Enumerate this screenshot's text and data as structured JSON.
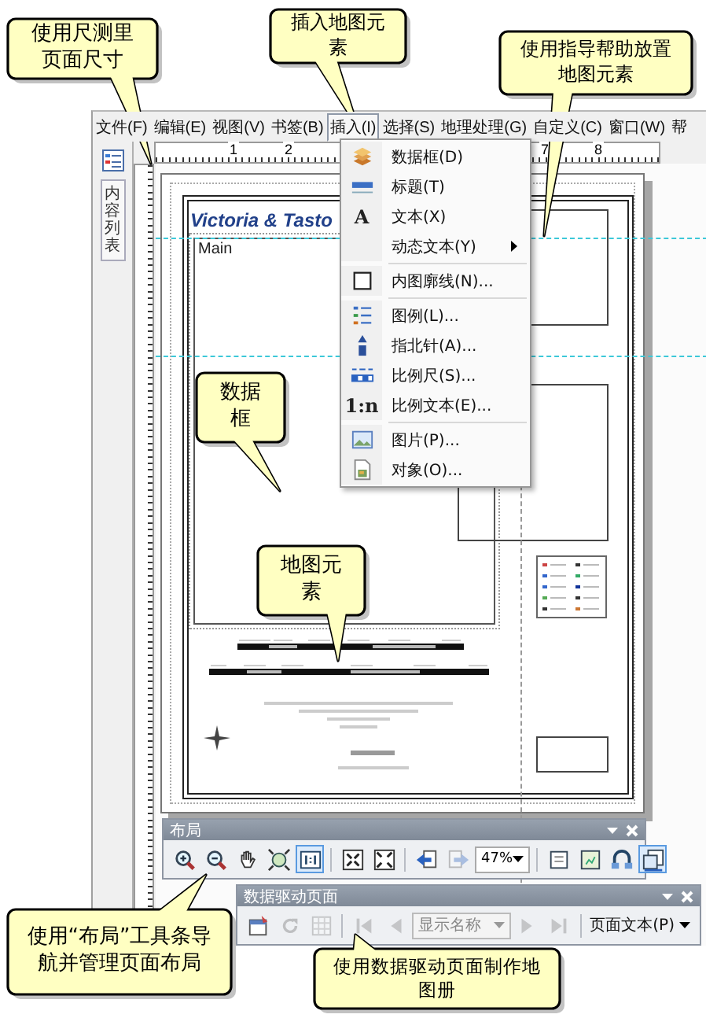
{
  "menu_bar": {
    "items": [
      {
        "label": "文件(F)",
        "selected": false
      },
      {
        "label": "编辑(E)",
        "selected": false
      },
      {
        "label": "视图(V)",
        "selected": false
      },
      {
        "label": "书签(B)",
        "selected": false
      },
      {
        "label": "插入(I)",
        "selected": true
      },
      {
        "label": "选择(S)",
        "selected": false
      },
      {
        "label": "地理处理(G)",
        "selected": false
      },
      {
        "label": "自定义(C)",
        "selected": false
      },
      {
        "label": "窗口(W)",
        "selected": false
      },
      {
        "label": "帮",
        "selected": false
      }
    ]
  },
  "insert_menu": {
    "groups": [
      [
        {
          "label": "数据框(D)",
          "kind": "data-frame",
          "submenu": false
        },
        {
          "label": "标题(T)",
          "kind": "title",
          "submenu": false
        },
        {
          "label": "文本(X)",
          "kind": "text",
          "glyph": "A",
          "submenu": false
        },
        {
          "label": "动态文本(Y)",
          "kind": "none",
          "submenu": true
        }
      ],
      [
        {
          "label": "内图廓线(N)...",
          "kind": "neatline",
          "submenu": false
        }
      ],
      [
        {
          "label": "图例(L)...",
          "kind": "legend",
          "submenu": false
        },
        {
          "label": "指北针(A)...",
          "kind": "north-arrow",
          "submenu": false
        },
        {
          "label": "比例尺(S)...",
          "kind": "scale-bar",
          "submenu": false
        },
        {
          "label": "比例文本(E)...",
          "kind": "text",
          "glyph": "1:n",
          "submenu": false
        }
      ],
      [
        {
          "label": "图片(P)...",
          "kind": "picture",
          "submenu": false
        },
        {
          "label": "对象(O)...",
          "kind": "object",
          "submenu": false
        }
      ]
    ]
  },
  "toc_tab": {
    "label": "内容列表"
  },
  "ruler": {
    "labels": [
      "1",
      "2",
      "7",
      "8"
    ]
  },
  "layout_page": {
    "title": "Victoria & Tasto",
    "main_frame_label": "Main"
  },
  "layout_toolbar": {
    "title": "布局",
    "zoom": "47%",
    "tools_left": [
      {
        "kind": "zoom-in",
        "selected": false,
        "disabled": false,
        "separator_before": false
      },
      {
        "kind": "zoom-out",
        "selected": false,
        "disabled": false,
        "separator_before": false
      },
      {
        "kind": "pan",
        "selected": false,
        "disabled": false,
        "separator_before": false
      },
      {
        "kind": "full-extent",
        "selected": false,
        "disabled": false,
        "separator_before": false
      },
      {
        "kind": "one-to-one",
        "selected": true,
        "disabled": false,
        "separator_before": false
      },
      {
        "kind": "fixed-zoom-in",
        "selected": false,
        "disabled": false,
        "separator_before": true
      },
      {
        "kind": "fixed-zoom-out",
        "selected": false,
        "disabled": false,
        "separator_before": false
      },
      {
        "kind": "back",
        "selected": false,
        "disabled": false,
        "separator_before": true
      },
      {
        "kind": "forward",
        "selected": false,
        "disabled": true,
        "separator_before": false
      }
    ],
    "tools_right": [
      {
        "kind": "toggle-draft",
        "selected": false,
        "disabled": false,
        "separator_before": true
      },
      {
        "kind": "focus",
        "selected": false,
        "disabled": false,
        "separator_before": false
      },
      {
        "kind": "change-layout",
        "selected": false,
        "disabled": false,
        "separator_before": false
      },
      {
        "kind": "data-driven",
        "selected": true,
        "disabled": false,
        "separator_before": false
      }
    ]
  },
  "ddp_toolbar": {
    "title": "数据驱动页面",
    "placeholder": "显示名称",
    "page_text_button": "页面文本(P)",
    "tools_left": [
      {
        "kind": "setup",
        "selected": false,
        "disabled": false,
        "separator_before": false
      },
      {
        "kind": "refresh",
        "selected": false,
        "disabled": true,
        "separator_before": false
      },
      {
        "kind": "table",
        "selected": false,
        "disabled": true,
        "separator_before": false
      },
      {
        "kind": "first",
        "selected": false,
        "disabled": true,
        "separator_before": true
      },
      {
        "kind": "prev",
        "selected": false,
        "disabled": true,
        "separator_before": false
      }
    ],
    "tools_right": [
      {
        "kind": "next",
        "selected": false,
        "disabled": true,
        "separator_before": false
      },
      {
        "kind": "last",
        "selected": false,
        "disabled": true,
        "separator_before": false
      }
    ]
  },
  "callouts": [
    {
      "text": "使用尺测里页面尺寸"
    },
    {
      "text": "插入地图元素"
    },
    {
      "text": "使用指导帮助放置地图元素"
    },
    {
      "text": "数据框"
    },
    {
      "text": "地图元素"
    },
    {
      "text": "使用“布局”工具条导航并管理页面布局"
    },
    {
      "text": "使用数据驱动页面制作地图册"
    }
  ]
}
